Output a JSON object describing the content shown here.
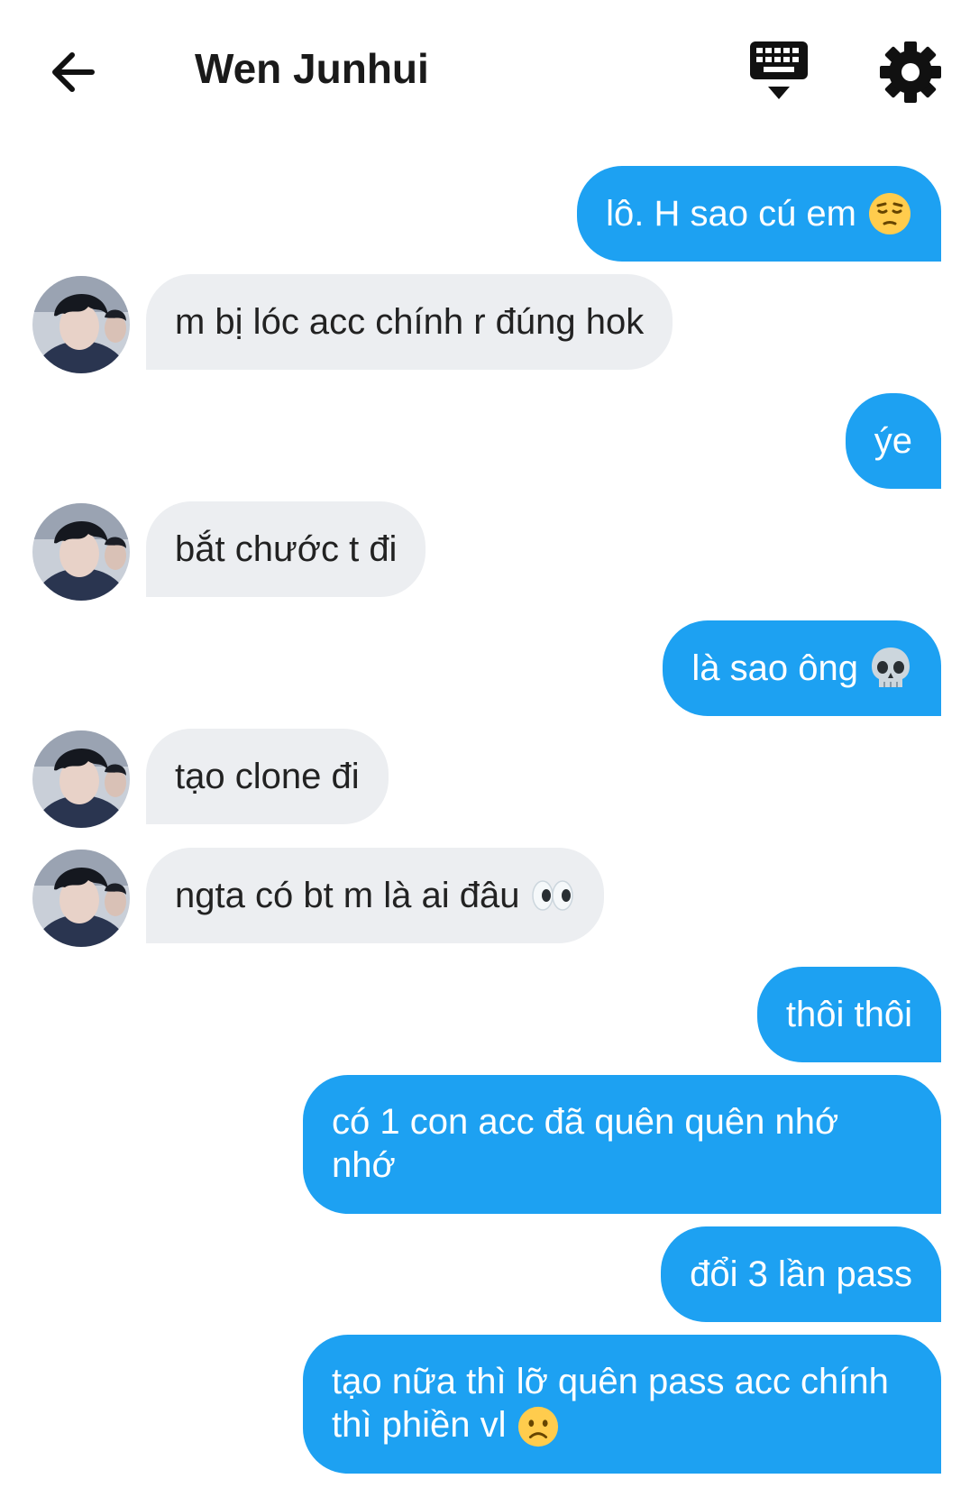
{
  "header": {
    "title": "Wen Junhui",
    "back_icon": "arrow-left-icon",
    "keyboard_icon": "keyboard-hide-icon",
    "settings_icon": "gear-icon"
  },
  "colors": {
    "sent_bubble": "#1da1f2",
    "received_bubble": "#eceef1"
  },
  "messages": [
    {
      "from": "me",
      "text": "lô. H sao cú em",
      "emoji": "pensive-face"
    },
    {
      "from": "them",
      "text": "m bị lóc acc chính r đúng hok"
    },
    {
      "from": "me",
      "text": "ýe"
    },
    {
      "from": "them",
      "text": "bắt chước t đi"
    },
    {
      "from": "me",
      "text": "là sao ông",
      "emoji": "skull"
    },
    {
      "from": "them",
      "text": "tạo clone đi"
    },
    {
      "from": "them",
      "text": "ngta có bt m là ai đâu",
      "emoji": "eyes"
    },
    {
      "from": "me",
      "text": "thôi thôi"
    },
    {
      "from": "me",
      "text": "có 1 con acc đã quên quên nhớ nhớ"
    },
    {
      "from": "me",
      "text": "đổi 3 lần pass"
    },
    {
      "from": "me",
      "text": "tạo nữa thì lỡ quên pass acc chính thì phiền vl",
      "emoji": "worried-face"
    }
  ]
}
